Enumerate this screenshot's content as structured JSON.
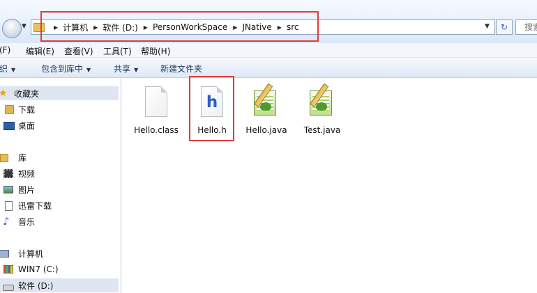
{
  "address": {
    "breadcrumbs": [
      "计算机",
      "软件 (D:)",
      "PersonWorkSpace",
      "JNative",
      "src"
    ],
    "separator": "▶",
    "refresh_glyph": "↻",
    "search_placeholder": "搜索"
  },
  "menu": {
    "items": [
      "(F)",
      "编辑(E)",
      "查看(V)",
      "工具(T)",
      "帮助(H)"
    ]
  },
  "commands": {
    "organize": "织",
    "include_in_library": "包含到库中",
    "share": "共享",
    "new_folder": "新建文件夹",
    "arrow": "▼"
  },
  "nav": {
    "favorites": "收藏夹",
    "downloads": "下载",
    "desktop": "桌面",
    "libraries": "库",
    "videos": "视频",
    "pictures": "图片",
    "thunder_downloads": "迅雷下载",
    "music": "音乐",
    "computer": "计算机",
    "drive_c": "WIN7 (C:)",
    "drive_d": "软件 (D:)"
  },
  "files": [
    {
      "name": "Hello.class",
      "icon": "blank-file-icon"
    },
    {
      "name": "Hello.h",
      "icon": "header-file-icon"
    },
    {
      "name": "Hello.java",
      "icon": "notepad-java-icon"
    },
    {
      "name": "Test.java",
      "icon": "notepad-java-icon"
    }
  ],
  "colors": {
    "highlight": "#e23b3b",
    "header_glyph": "#2b5bc4",
    "selection": "#dfe6f1"
  }
}
